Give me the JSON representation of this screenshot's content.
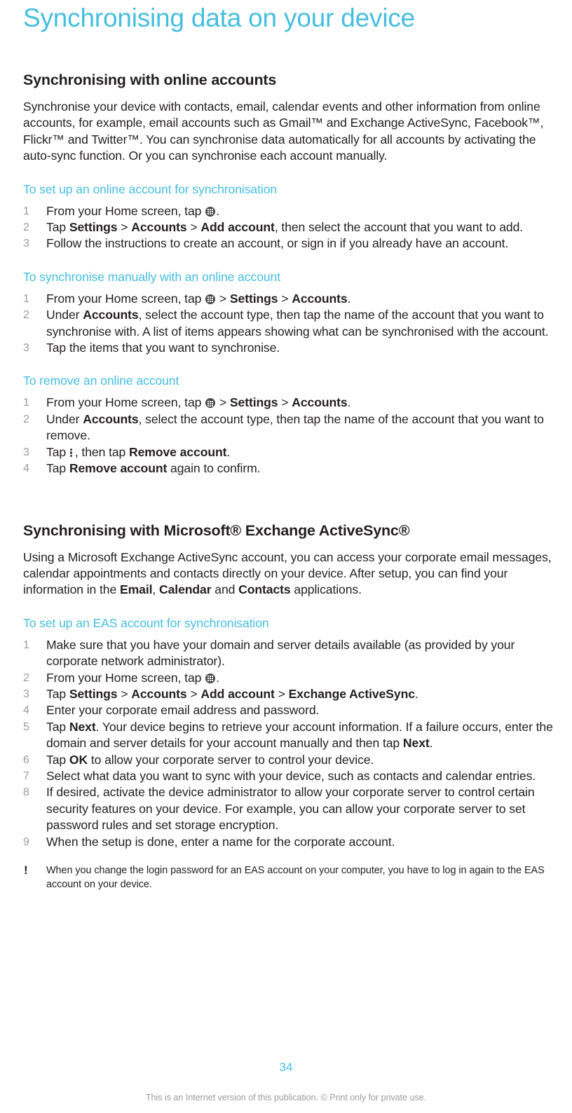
{
  "document": {
    "title": "Synchronising data on your device",
    "accent_color": "#45bee0",
    "text_color": "#231f20",
    "muted_color": "#9b9b9b"
  },
  "sections": [
    {
      "heading": "Synchronising with online accounts",
      "intro": "Synchronise your device with contacts, email, calendar events and other information from online accounts, for example, email accounts such as Gmail™ and Exchange ActiveSync, Facebook™, Flickr™ and Twitter™. You can synchronise data automatically for all accounts by activating the auto-sync function. Or you can synchronise each account manually.",
      "procedures": [
        {
          "heading": "To set up an online account for synchronisation",
          "steps": {
            "s1_a": "From your Home screen, tap ",
            "s1_b": ".",
            "s2_tap": "Tap ",
            "s2_settings": "Settings",
            "s2_gt1": " > ",
            "s2_accounts": "Accounts",
            "s2_gt2": " > ",
            "s2_addaccount": "Add account",
            "s2_tail": ", then select the account that you want to add.",
            "s3": "Follow the instructions to create an account, or sign in if you already have an account."
          }
        },
        {
          "heading": "To synchronise manually with an online account",
          "steps": {
            "s1_a": "From your Home screen, tap ",
            "s1_gt1": " > ",
            "s1_settings": "Settings",
            "s1_gt2": " > ",
            "s1_accounts": "Accounts",
            "s1_tail": ".",
            "s2_under": "Under ",
            "s2_accounts": "Accounts",
            "s2_tail": ", select the account type, then tap the name of the account that you want to synchronise with. A list of items appears showing what can be synchronised with the account.",
            "s3": "Tap the items that you want to synchronise."
          }
        },
        {
          "heading": "To remove an online account",
          "steps": {
            "s1_a": "From your Home screen, tap ",
            "s1_gt1": " > ",
            "s1_settings": "Settings",
            "s1_gt2": " > ",
            "s1_accounts": "Accounts",
            "s1_tail": ".",
            "s2_under": "Under ",
            "s2_accounts": "Accounts",
            "s2_tail": ", select the account type, then tap the name of the account that you want to remove.",
            "s3_a": "Tap ",
            "s3_b": ", then tap ",
            "s3_remove": "Remove account",
            "s3_tail": ".",
            "s4_a": "Tap ",
            "s4_remove": "Remove account",
            "s4_tail": " again to confirm."
          }
        }
      ]
    },
    {
      "heading": "Synchronising with Microsoft® Exchange ActiveSync®",
      "intro_a": "Using a Microsoft Exchange ActiveSync account, you can access your corporate email messages, calendar appointments and contacts directly on your device. After setup, you can find your information in the ",
      "intro_email": "Email",
      "intro_sep1": ", ",
      "intro_calendar": "Calendar",
      "intro_sep2": " and ",
      "intro_contacts": "Contacts",
      "intro_tail": " applications.",
      "procedures": [
        {
          "heading": "To set up an EAS account for synchronisation",
          "steps": {
            "s1": "Make sure that you have your domain and server details available (as provided by your corporate network administrator).",
            "s2_a": "From your Home screen, tap ",
            "s2_b": ".",
            "s3_tap": "Tap ",
            "s3_settings": "Settings",
            "s3_gt1": " > ",
            "s3_accounts": "Accounts",
            "s3_gt2": " > ",
            "s3_addaccount": "Add account",
            "s3_gt3": " > ",
            "s3_eas": "Exchange ActiveSync",
            "s3_tail": ".",
            "s4": "Enter your corporate email address and password.",
            "s5_a": "Tap ",
            "s5_next1": "Next",
            "s5_b": ". Your device begins to retrieve your account information. If a failure occurs, enter the domain and server details for your account manually and then tap ",
            "s5_next2": "Next",
            "s5_tail": ".",
            "s6_a": "Tap ",
            "s6_ok": "OK",
            "s6_tail": " to allow your corporate server to control your device.",
            "s7": "Select what data you want to sync with your device, such as contacts and calendar entries.",
            "s8": "If desired, activate the device administrator to allow your corporate server to control certain security features on your device. For example, you can allow your corporate server to set password rules and set storage encryption.",
            "s9": "When the setup is done, enter a name for the corporate account."
          }
        }
      ],
      "note": {
        "marker": "!",
        "text": "When you change the login password for an EAS account on your computer, you have to log in again to the EAS account on your device."
      }
    }
  ],
  "footer": {
    "page_number": "34",
    "legal": "This is an Internet version of this publication. © Print only for private use."
  },
  "icons": {
    "app_drawer": "app-drawer-icon",
    "overflow": "overflow-menu-icon"
  }
}
